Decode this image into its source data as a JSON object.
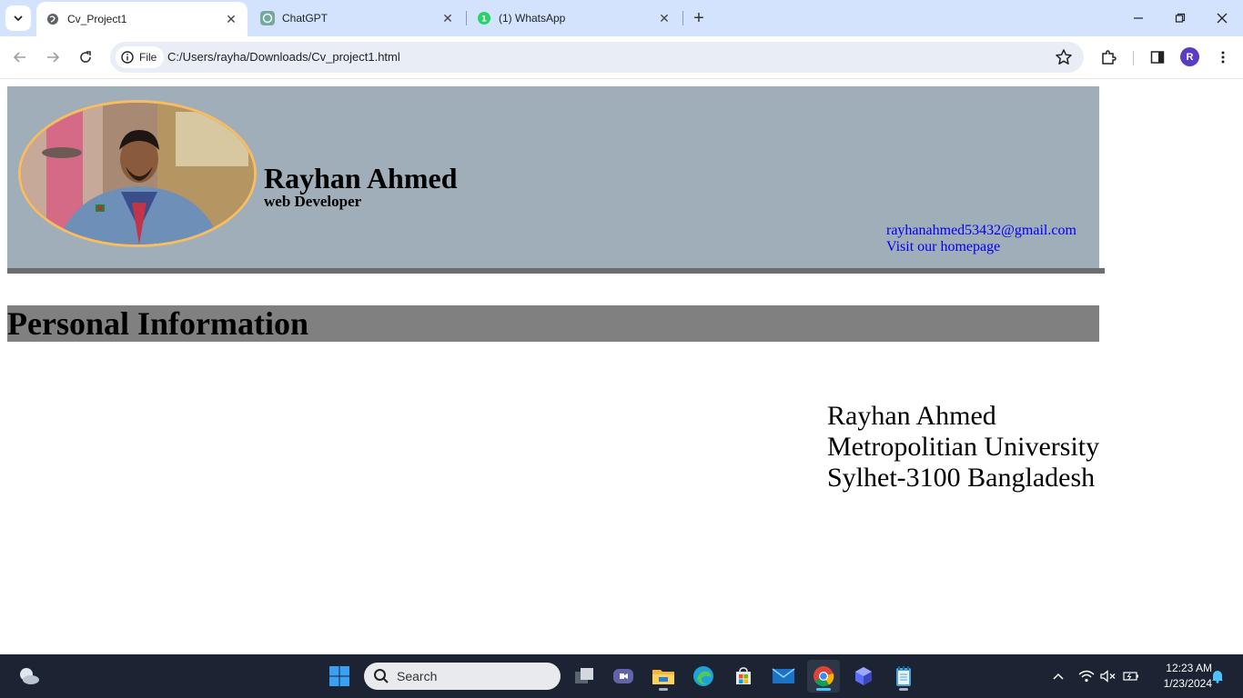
{
  "browser": {
    "tabs": [
      {
        "title": "Cv_Project1",
        "active": true,
        "icon": "globe-icon"
      },
      {
        "title": "ChatGPT",
        "active": false,
        "icon": "chatgpt-icon"
      },
      {
        "title": "(1) WhatsApp",
        "active": false,
        "icon": "whatsapp-icon"
      }
    ],
    "omnibox": {
      "chip_label": "File",
      "url": "C:/Users/rayha/Downloads/Cv_project1.html"
    },
    "profile_initial": "R",
    "accent_color": "#d3e3fd"
  },
  "cv": {
    "header": {
      "name": "Rayhan Ahmed",
      "role": "web Developer",
      "email": "rayhanahmed53432@gmail.com",
      "homepage_link": "Visit our homepage",
      "background_color": "#9faeb9",
      "photo_border_color": "#f7bd63"
    },
    "section": {
      "title": "Personal Information",
      "background_color": "#808080"
    },
    "address": {
      "line1": "Rayhan Ahmed",
      "line2": "Metropolitian University",
      "line3": "Sylhet-3100 Bangladesh"
    }
  },
  "taskbar": {
    "search_placeholder": "Search",
    "time": "12:23 AM",
    "date": "1/23/2024"
  }
}
